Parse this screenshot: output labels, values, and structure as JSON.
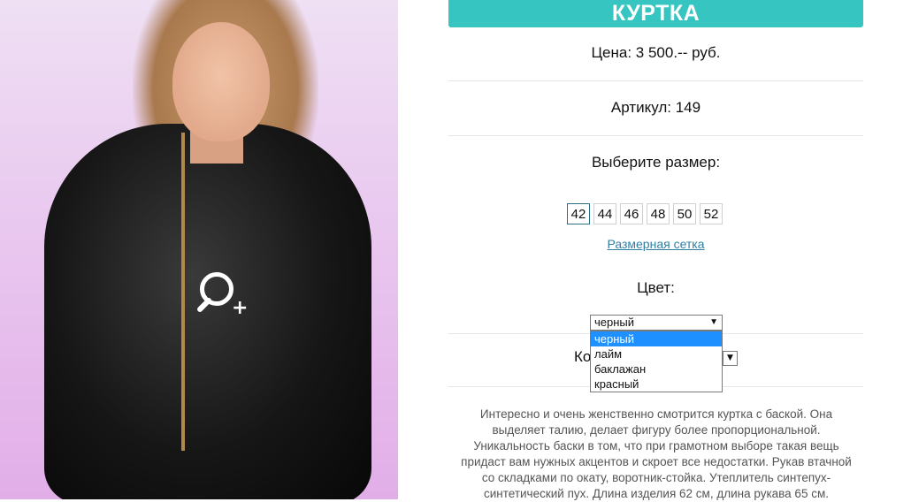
{
  "product": {
    "title": "КУРТКА",
    "price": "Цена: 3 500.-- руб.",
    "sku": "Артикул: 149",
    "size_label": "Выберите размер:",
    "sizes": [
      "42",
      "44",
      "46",
      "48",
      "50",
      "52"
    ],
    "selected_size": "42",
    "size_chart_link": "Размерная сетка",
    "color_label": "Цвет:",
    "color_selected": "черный",
    "color_options": [
      "черный",
      "лайм",
      "баклажан",
      "красный"
    ],
    "quantity_label_partial": "Ко",
    "description": "Интересно и очень женственно смотрится куртка с баской. Она выделяет талию, делает фигуру более пропорциональной. Уникальность баски в том, что при грамотном выборе такая вещь придаст вам нужных акцентов и скроет все недостатки. Рукав втачной со складками по окату, воротник-стойка. Утеплитель синтепух-синтетический пух. Длина изделия 62 см, длина рукава 65 см."
  },
  "colors": {
    "accent": "#36c5c1",
    "link": "#2f7fa3",
    "dropdown_highlight": "#1e90ff"
  },
  "icons": {
    "zoom": "zoom-in-icon",
    "dropdown_arrow": "chevron-down-icon"
  }
}
